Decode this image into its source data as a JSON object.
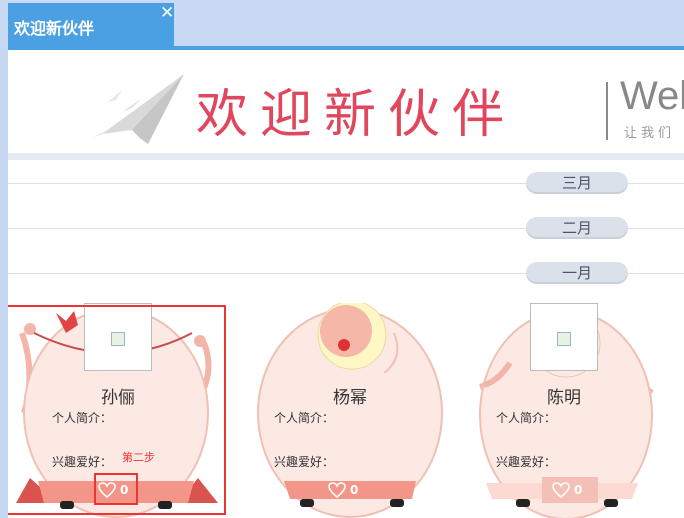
{
  "tab": {
    "title": "欢迎新伙伴",
    "close_glyph": "✕"
  },
  "banner": {
    "title": "欢迎新伙伴",
    "welcome": "Wel",
    "subtitle": "让我们"
  },
  "timeline": {
    "months": [
      "三月",
      "二月",
      "一月"
    ]
  },
  "cards": [
    {
      "name": "孙俪",
      "intro_label": "个人简介：",
      "hobby_label": "兴趣爱好：",
      "likes": "0",
      "annotation": "第二步"
    },
    {
      "name": "杨幂",
      "intro_label": "个人简介：",
      "hobby_label": "兴趣爱好：",
      "likes": "0"
    },
    {
      "name": "陈明",
      "intro_label": "个人简介：",
      "hobby_label": "兴趣爱好：",
      "likes": "0"
    }
  ],
  "colors": {
    "tab_blue": "#4aa0e2",
    "title_red": "#e0475e",
    "egg_fill": "#fde9e4",
    "like_bar": "#f4958a",
    "annotation_red": "#e33333"
  },
  "icons": {
    "like": "heart-outline-icon",
    "plane": "paper-plane-icon",
    "close": "close-icon"
  }
}
